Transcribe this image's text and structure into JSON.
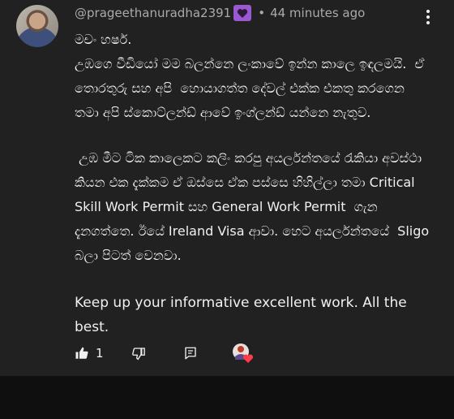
{
  "comment": {
    "author": "@prageethanuradha2391",
    "separator": "•",
    "timestamp": "44 minutes ago",
    "paragraphs": [
      "මචං හර්ෂ.\nඋඹගෙ වීඩියෝ මම බලන්නෙ ලංකාවේ ඉන්න කාලෙ ඉඳලමයි.  ඒ තොරතුරු සහ අපි  හොයාගත්ත දේවල් එක්ක එකතු කරගෙන තමා අපි ස්කොට්ලන්ඩ් ආවේ ඉංග්ලන්ඩ් යන්නෙ නැතුව.",
      " උඹ මීට ටික කාලෙකට කලිං කරපු අයර්ලන්තයේ රැකියා අවස්ථා කියන එක දැක්කම ඒ ඔස්සෙ ඒක පස්සෙ හිහිල්ලා තමා Critical Skill Work Permit සහ General Work Permit  ගැන දැනගත්තෙ. ඊයේ Ireland Visa ආවා. හෙට අයර්ලන්තයේ  Sligo බලා පිටත් වෙනවා.",
      "Keep up your informative excellent work. All the best."
    ],
    "like_count": "1"
  },
  "icons": {
    "badge": "member-heart-badge-icon",
    "menu": "more-vert-icon",
    "like": "thumb-up-icon",
    "dislike": "thumb-down-icon",
    "reply": "reply-icon",
    "creator_heart": "creator-heart-icon"
  },
  "colors": {
    "background": "#212121",
    "text": "#f1f1f1",
    "meta_text": "#aaaaaa",
    "badge": "#9b59d0",
    "heart": "#ff3b47"
  }
}
